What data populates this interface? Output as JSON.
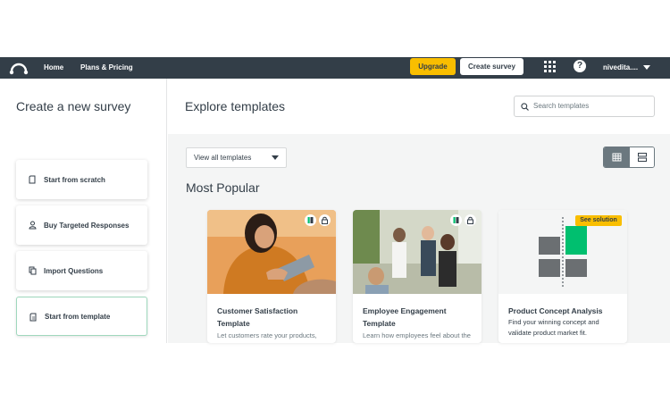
{
  "topnav": {
    "home_label": "Home",
    "plans_label": "Plans & Pricing",
    "upgrade_label": "Upgrade",
    "create_survey_label": "Create survey",
    "help_label": "?",
    "user_name": "nivedita....",
    "bg_color": "#333e48",
    "upgrade_color": "#f9be00"
  },
  "left": {
    "title": "Create a new survey",
    "options": [
      {
        "label": "Start from scratch",
        "icon": "page-icon"
      },
      {
        "label": "Buy Targeted Responses",
        "icon": "person-icon"
      },
      {
        "label": "Import Questions",
        "icon": "copy-icon"
      },
      {
        "label": "Start from template",
        "icon": "template-icon",
        "active": true
      }
    ]
  },
  "main": {
    "title": "Explore templates",
    "search_placeholder": "Search templates",
    "filter_value": "View all templates",
    "section_title": "Most Popular",
    "cards": [
      {
        "title": "Customer Satisfaction Template",
        "desc": "Let customers rate your products, service and quality"
      },
      {
        "title": "Employee Engagement Template",
        "desc": "Learn how employees feel about the work and how you can help"
      },
      {
        "title": "Product Concept Analysis",
        "desc": "Find your winning concept and validate product market fit.",
        "badge": "See solution"
      }
    ]
  }
}
